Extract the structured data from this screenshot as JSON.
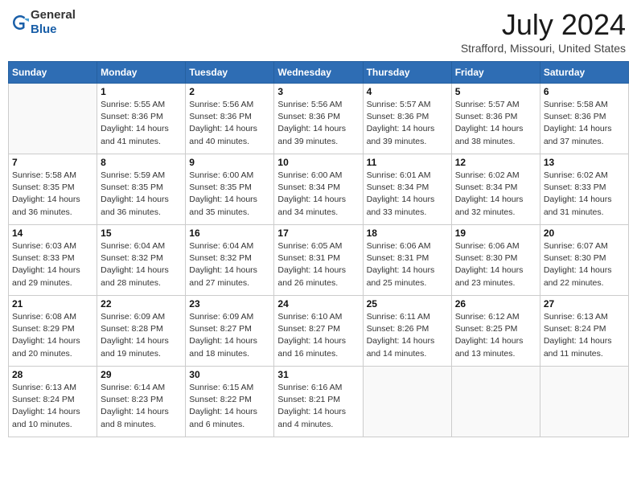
{
  "header": {
    "logo_line1": "General",
    "logo_line2": "Blue",
    "month": "July 2024",
    "location": "Strafford, Missouri, United States"
  },
  "days_of_week": [
    "Sunday",
    "Monday",
    "Tuesday",
    "Wednesday",
    "Thursday",
    "Friday",
    "Saturday"
  ],
  "weeks": [
    [
      {
        "day": "",
        "info": ""
      },
      {
        "day": "1",
        "info": "Sunrise: 5:55 AM\nSunset: 8:36 PM\nDaylight: 14 hours\nand 41 minutes."
      },
      {
        "day": "2",
        "info": "Sunrise: 5:56 AM\nSunset: 8:36 PM\nDaylight: 14 hours\nand 40 minutes."
      },
      {
        "day": "3",
        "info": "Sunrise: 5:56 AM\nSunset: 8:36 PM\nDaylight: 14 hours\nand 39 minutes."
      },
      {
        "day": "4",
        "info": "Sunrise: 5:57 AM\nSunset: 8:36 PM\nDaylight: 14 hours\nand 39 minutes."
      },
      {
        "day": "5",
        "info": "Sunrise: 5:57 AM\nSunset: 8:36 PM\nDaylight: 14 hours\nand 38 minutes."
      },
      {
        "day": "6",
        "info": "Sunrise: 5:58 AM\nSunset: 8:36 PM\nDaylight: 14 hours\nand 37 minutes."
      }
    ],
    [
      {
        "day": "7",
        "info": "Sunrise: 5:58 AM\nSunset: 8:35 PM\nDaylight: 14 hours\nand 36 minutes."
      },
      {
        "day": "8",
        "info": "Sunrise: 5:59 AM\nSunset: 8:35 PM\nDaylight: 14 hours\nand 36 minutes."
      },
      {
        "day": "9",
        "info": "Sunrise: 6:00 AM\nSunset: 8:35 PM\nDaylight: 14 hours\nand 35 minutes."
      },
      {
        "day": "10",
        "info": "Sunrise: 6:00 AM\nSunset: 8:34 PM\nDaylight: 14 hours\nand 34 minutes."
      },
      {
        "day": "11",
        "info": "Sunrise: 6:01 AM\nSunset: 8:34 PM\nDaylight: 14 hours\nand 33 minutes."
      },
      {
        "day": "12",
        "info": "Sunrise: 6:02 AM\nSunset: 8:34 PM\nDaylight: 14 hours\nand 32 minutes."
      },
      {
        "day": "13",
        "info": "Sunrise: 6:02 AM\nSunset: 8:33 PM\nDaylight: 14 hours\nand 31 minutes."
      }
    ],
    [
      {
        "day": "14",
        "info": "Sunrise: 6:03 AM\nSunset: 8:33 PM\nDaylight: 14 hours\nand 29 minutes."
      },
      {
        "day": "15",
        "info": "Sunrise: 6:04 AM\nSunset: 8:32 PM\nDaylight: 14 hours\nand 28 minutes."
      },
      {
        "day": "16",
        "info": "Sunrise: 6:04 AM\nSunset: 8:32 PM\nDaylight: 14 hours\nand 27 minutes."
      },
      {
        "day": "17",
        "info": "Sunrise: 6:05 AM\nSunset: 8:31 PM\nDaylight: 14 hours\nand 26 minutes."
      },
      {
        "day": "18",
        "info": "Sunrise: 6:06 AM\nSunset: 8:31 PM\nDaylight: 14 hours\nand 25 minutes."
      },
      {
        "day": "19",
        "info": "Sunrise: 6:06 AM\nSunset: 8:30 PM\nDaylight: 14 hours\nand 23 minutes."
      },
      {
        "day": "20",
        "info": "Sunrise: 6:07 AM\nSunset: 8:30 PM\nDaylight: 14 hours\nand 22 minutes."
      }
    ],
    [
      {
        "day": "21",
        "info": "Sunrise: 6:08 AM\nSunset: 8:29 PM\nDaylight: 14 hours\nand 20 minutes."
      },
      {
        "day": "22",
        "info": "Sunrise: 6:09 AM\nSunset: 8:28 PM\nDaylight: 14 hours\nand 19 minutes."
      },
      {
        "day": "23",
        "info": "Sunrise: 6:09 AM\nSunset: 8:27 PM\nDaylight: 14 hours\nand 18 minutes."
      },
      {
        "day": "24",
        "info": "Sunrise: 6:10 AM\nSunset: 8:27 PM\nDaylight: 14 hours\nand 16 minutes."
      },
      {
        "day": "25",
        "info": "Sunrise: 6:11 AM\nSunset: 8:26 PM\nDaylight: 14 hours\nand 14 minutes."
      },
      {
        "day": "26",
        "info": "Sunrise: 6:12 AM\nSunset: 8:25 PM\nDaylight: 14 hours\nand 13 minutes."
      },
      {
        "day": "27",
        "info": "Sunrise: 6:13 AM\nSunset: 8:24 PM\nDaylight: 14 hours\nand 11 minutes."
      }
    ],
    [
      {
        "day": "28",
        "info": "Sunrise: 6:13 AM\nSunset: 8:24 PM\nDaylight: 14 hours\nand 10 minutes."
      },
      {
        "day": "29",
        "info": "Sunrise: 6:14 AM\nSunset: 8:23 PM\nDaylight: 14 hours\nand 8 minutes."
      },
      {
        "day": "30",
        "info": "Sunrise: 6:15 AM\nSunset: 8:22 PM\nDaylight: 14 hours\nand 6 minutes."
      },
      {
        "day": "31",
        "info": "Sunrise: 6:16 AM\nSunset: 8:21 PM\nDaylight: 14 hours\nand 4 minutes."
      },
      {
        "day": "",
        "info": ""
      },
      {
        "day": "",
        "info": ""
      },
      {
        "day": "",
        "info": ""
      }
    ]
  ]
}
